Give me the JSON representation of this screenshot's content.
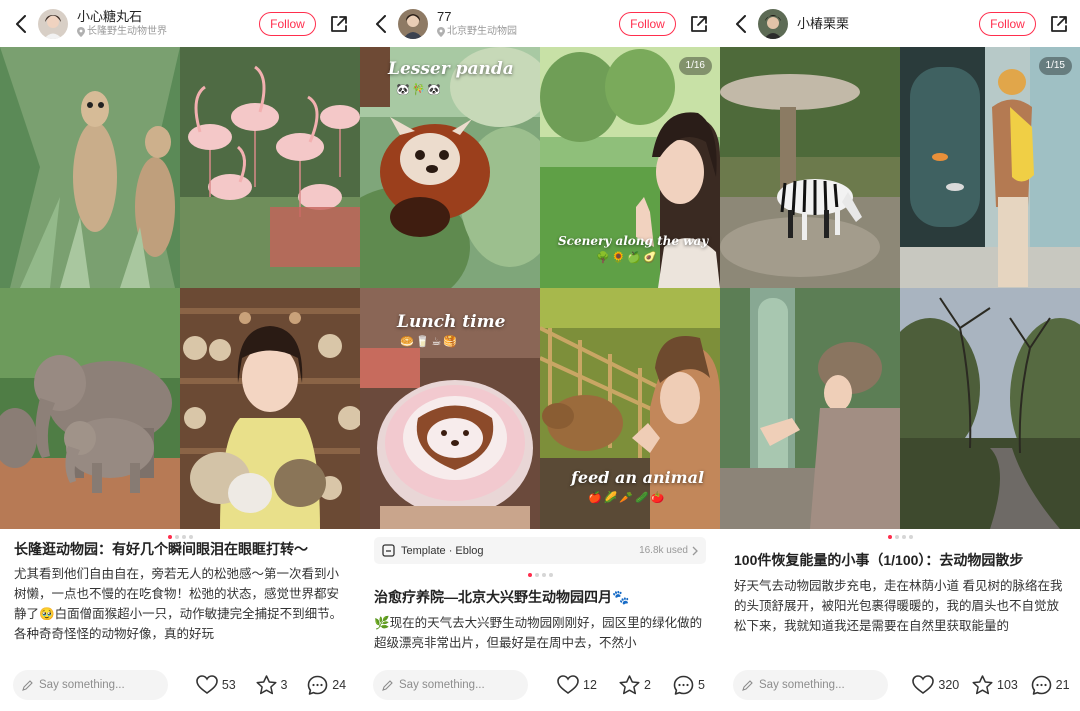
{
  "panels": [
    {
      "user": {
        "name": "77",
        "location": "北京野生动物园"
      },
      "follow_label": "Follow",
      "counter": "1/16",
      "captions": [
        "Lesser panda",
        "Scenery along the way",
        "Lunch time",
        "feed an animal"
      ],
      "caption_emojis": [
        "🐼🎋🐼",
        "🌳🌻🍏🥑",
        "🥯🥛☕🥞",
        "🍎🌽🥕🥒🍅"
      ],
      "template": {
        "label": "Template · Eblog",
        "used": "16.8k used"
      },
      "title": "治愈疗养院—北京大兴野生动物园四月🐾",
      "body": "🌿现在的天气去大兴野生动物园刚刚好，园区里的绿化做的超级漂亮非常出片，但最好是在周中去，不然小",
      "say_placeholder": "Say something...",
      "likes": "12",
      "stars": "2",
      "comments": "5"
    },
    {
      "user": {
        "name": "小椿栗栗",
        "location": ""
      },
      "follow_label": "Follow",
      "counter": "1/15",
      "title": "100件恢复能量的小事（1/100）：去动物园散步",
      "body": "好天气去动物园散步充电，走在林荫小道 看见树的脉络在我的头顶舒展开，被阳光包裹得暖暖的，我的眉头也不自觉放松下来，我就知道我还是需要在自然里获取能量的",
      "say_placeholder": "Say something...",
      "likes": "320",
      "stars": "103",
      "comments": "21"
    },
    {
      "user": {
        "name": "小心糖丸石",
        "location": "长隆野生动物世界"
      },
      "follow_label": "Follow",
      "title": "长隆逛动物园：有好几个瞬间眼泪在眼眶打转～",
      "body": "尤其看到他们自由自在，旁若无人的松弛感～第一次看到小树懒，一点也不慢的在吃食物！松弛的状态，感觉世界都安静了🥹白面僧面猴超小一只，动作敏捷完全捕捉不到细节。各种奇奇怪怪的动物好像，真的好玩",
      "say_placeholder": "Say something...",
      "likes": "53",
      "stars": "3",
      "comments": "24"
    }
  ],
  "colors": {
    "accent": "#ff2e4d",
    "muted": "#9a9a9a",
    "input_bg": "#f4f4f4"
  },
  "icons": [
    "back-arrow-icon",
    "share-icon",
    "location-pin-icon",
    "heart-icon",
    "star-icon",
    "comment-icon",
    "pencil-icon",
    "template-icon"
  ]
}
